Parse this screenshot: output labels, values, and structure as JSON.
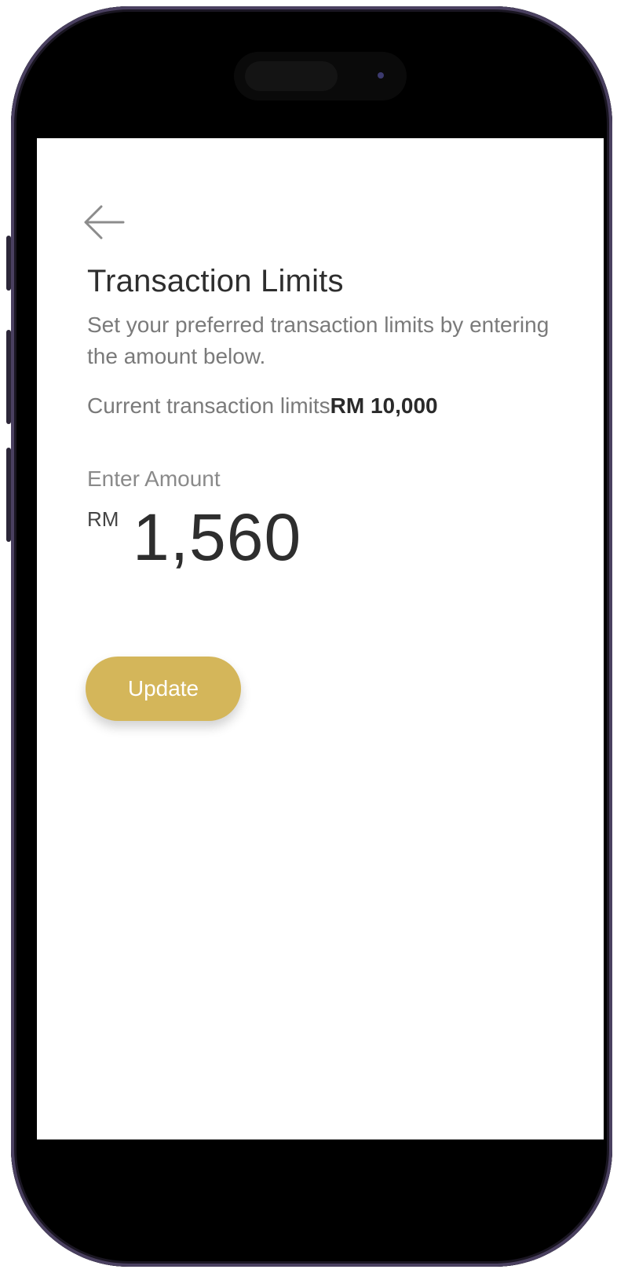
{
  "header": {
    "title": "Transaction Limits",
    "subtitle": "Set your preferred transaction limits by entering the amount below."
  },
  "current_limit": {
    "label": "Current transaction limits",
    "value": "RM 10,000"
  },
  "amount_input": {
    "label": "Enter Amount",
    "currency": "RM",
    "value": "1,560"
  },
  "actions": {
    "update_label": "Update"
  },
  "icons": {
    "back": "arrow-left-icon"
  },
  "colors": {
    "accent": "#d4b65a",
    "title_text": "#2e2e2e",
    "muted_text": "#7a7a7a",
    "frame": "#000000"
  }
}
